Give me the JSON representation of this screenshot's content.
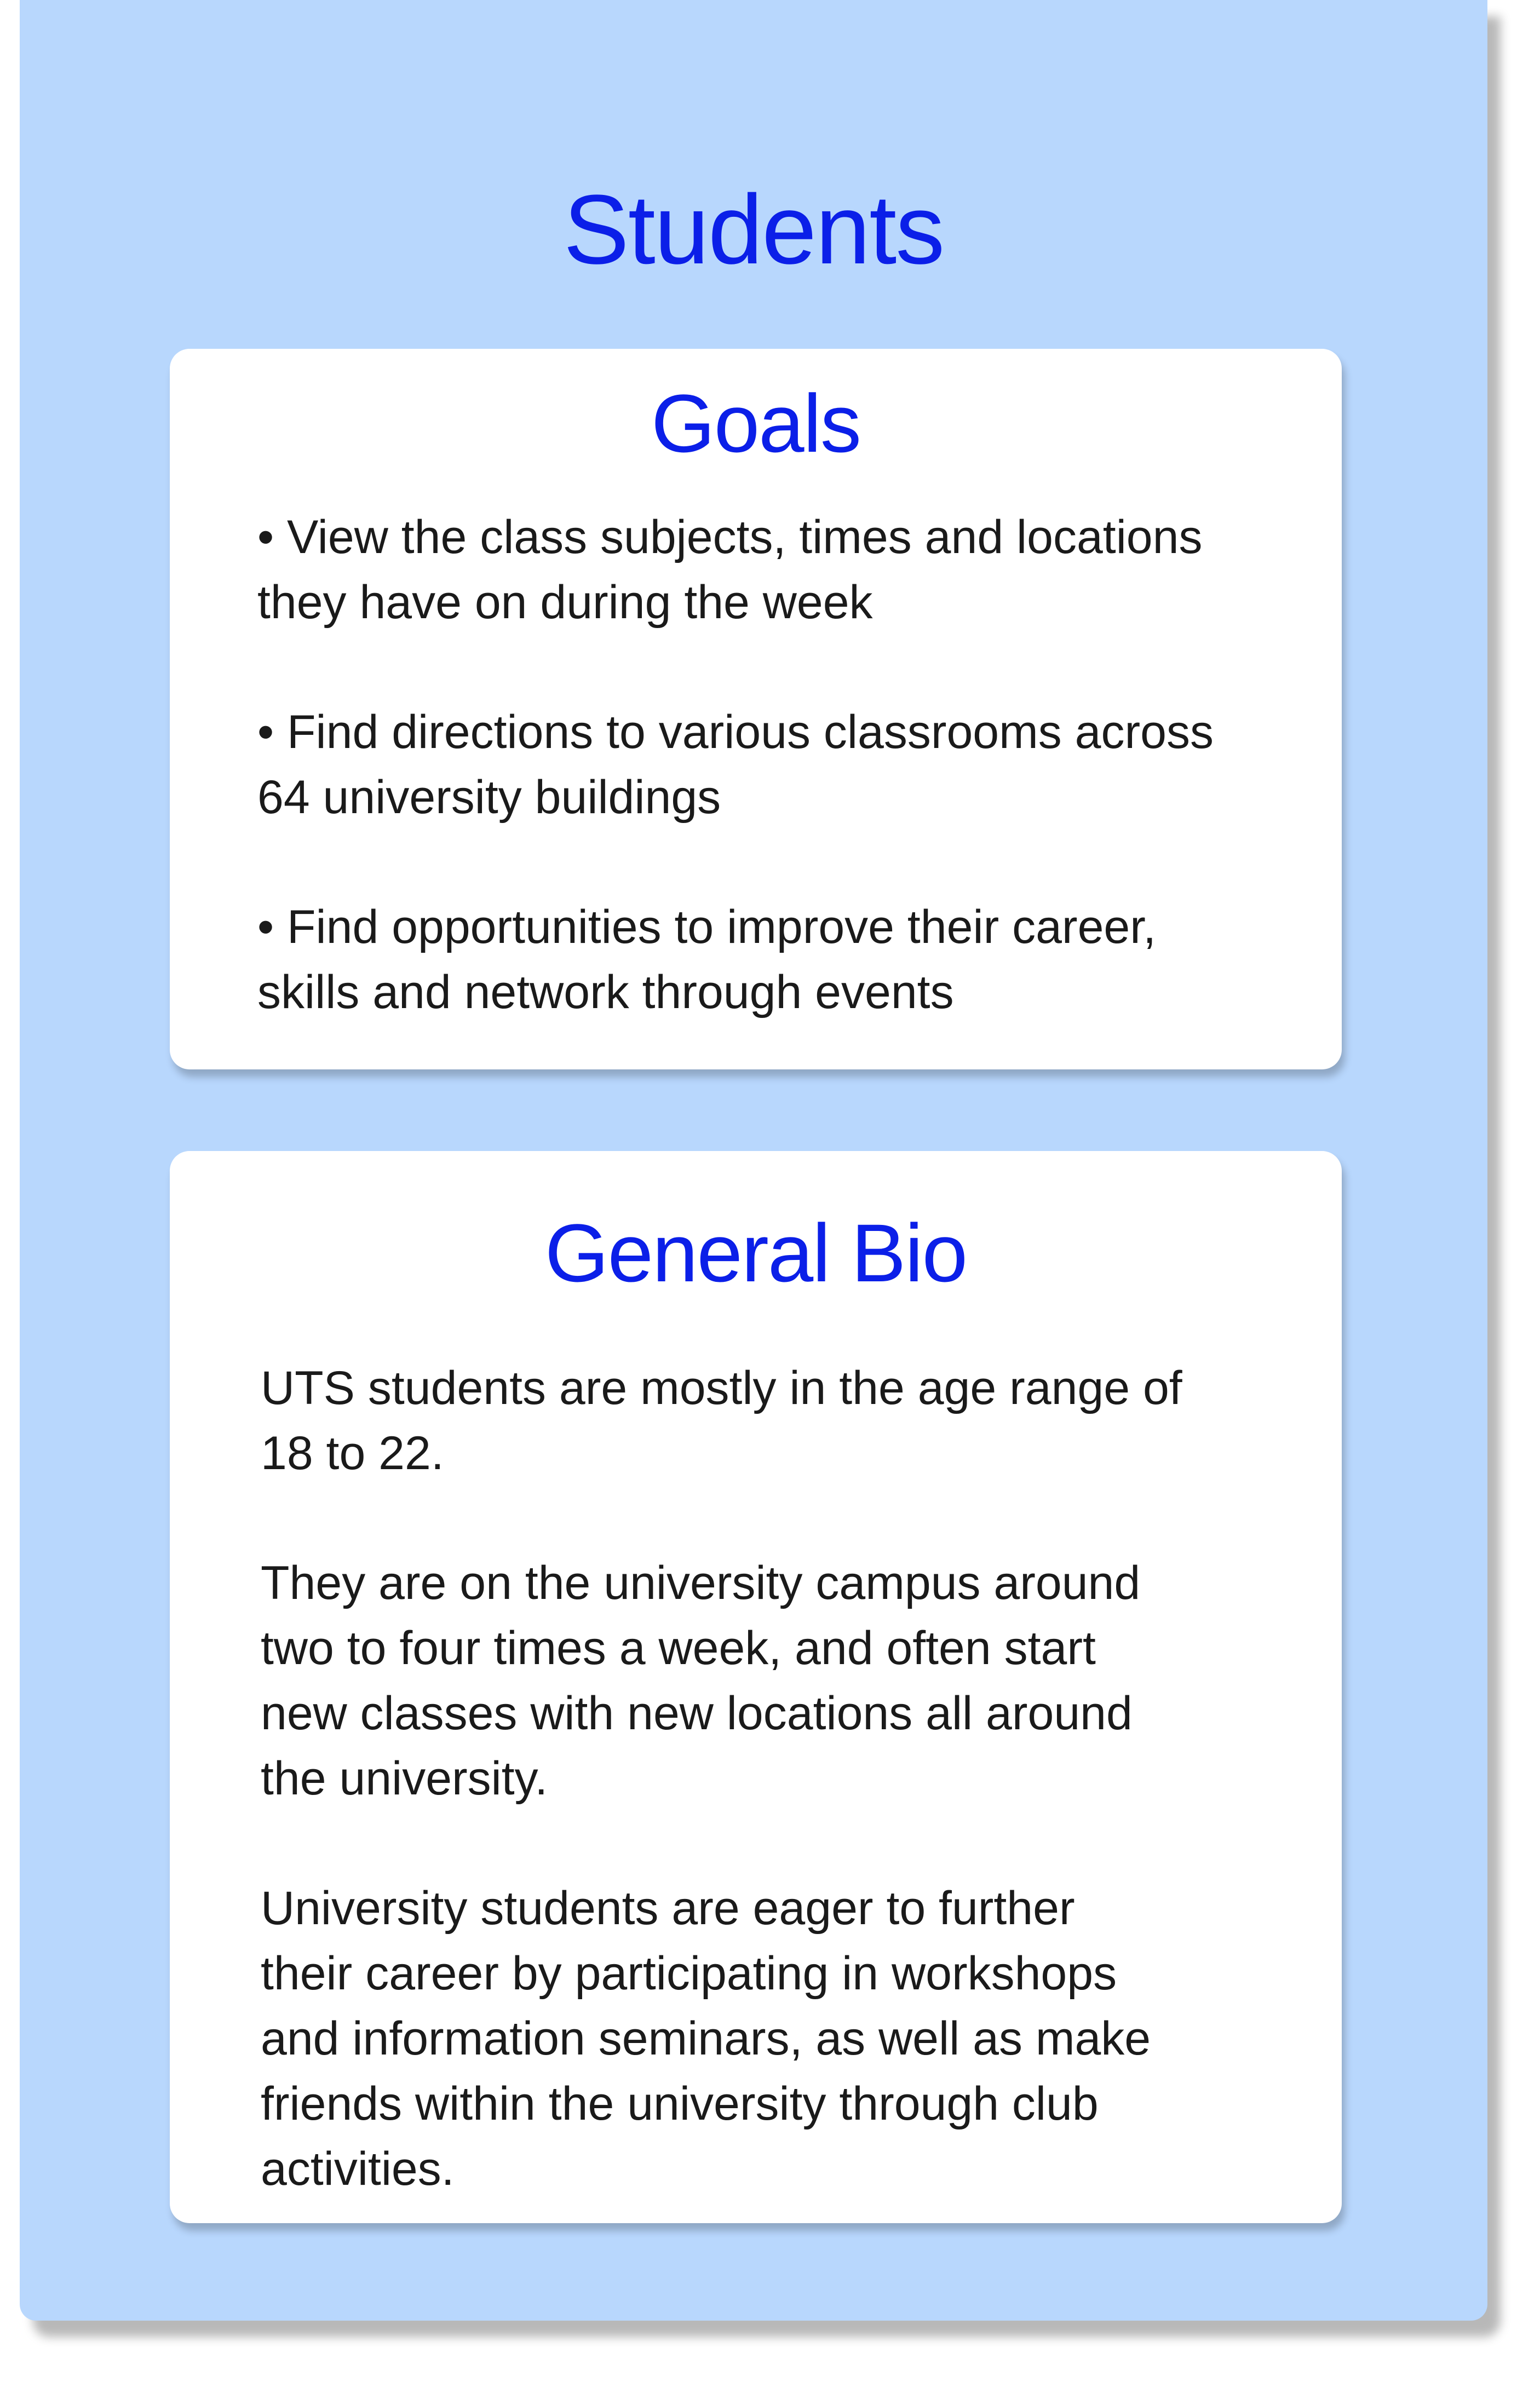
{
  "title": "Students",
  "goals": {
    "heading": "Goals",
    "items": [
      {
        "lines": [
          "• View the class subjects, times and locations",
          "they have on during the week"
        ]
      },
      {
        "lines": [
          "• Find directions to various classrooms across",
          "64 university buildings"
        ]
      },
      {
        "lines": [
          "• Find opportunities to improve their career,",
          "skills and network through events"
        ]
      }
    ]
  },
  "bio": {
    "heading": "General Bio",
    "paragraphs": [
      {
        "lines": [
          "UTS students are mostly in the age range of",
          "18 to 22."
        ]
      },
      {
        "lines": [
          "They are on the university campus around",
          "two to four times a week, and often start",
          "new classes with new locations all around",
          "the university."
        ]
      },
      {
        "lines": [
          "University students are eager to further",
          "their career by participating in workshops",
          "and information seminars, as well as make",
          "friends within the university through club",
          "activities."
        ]
      }
    ]
  },
  "colors": {
    "panel_background": "#b8d7fd",
    "accent_blue": "#0b1fe8",
    "card_background": "#ffffff",
    "body_text": "#1a1a1a"
  }
}
